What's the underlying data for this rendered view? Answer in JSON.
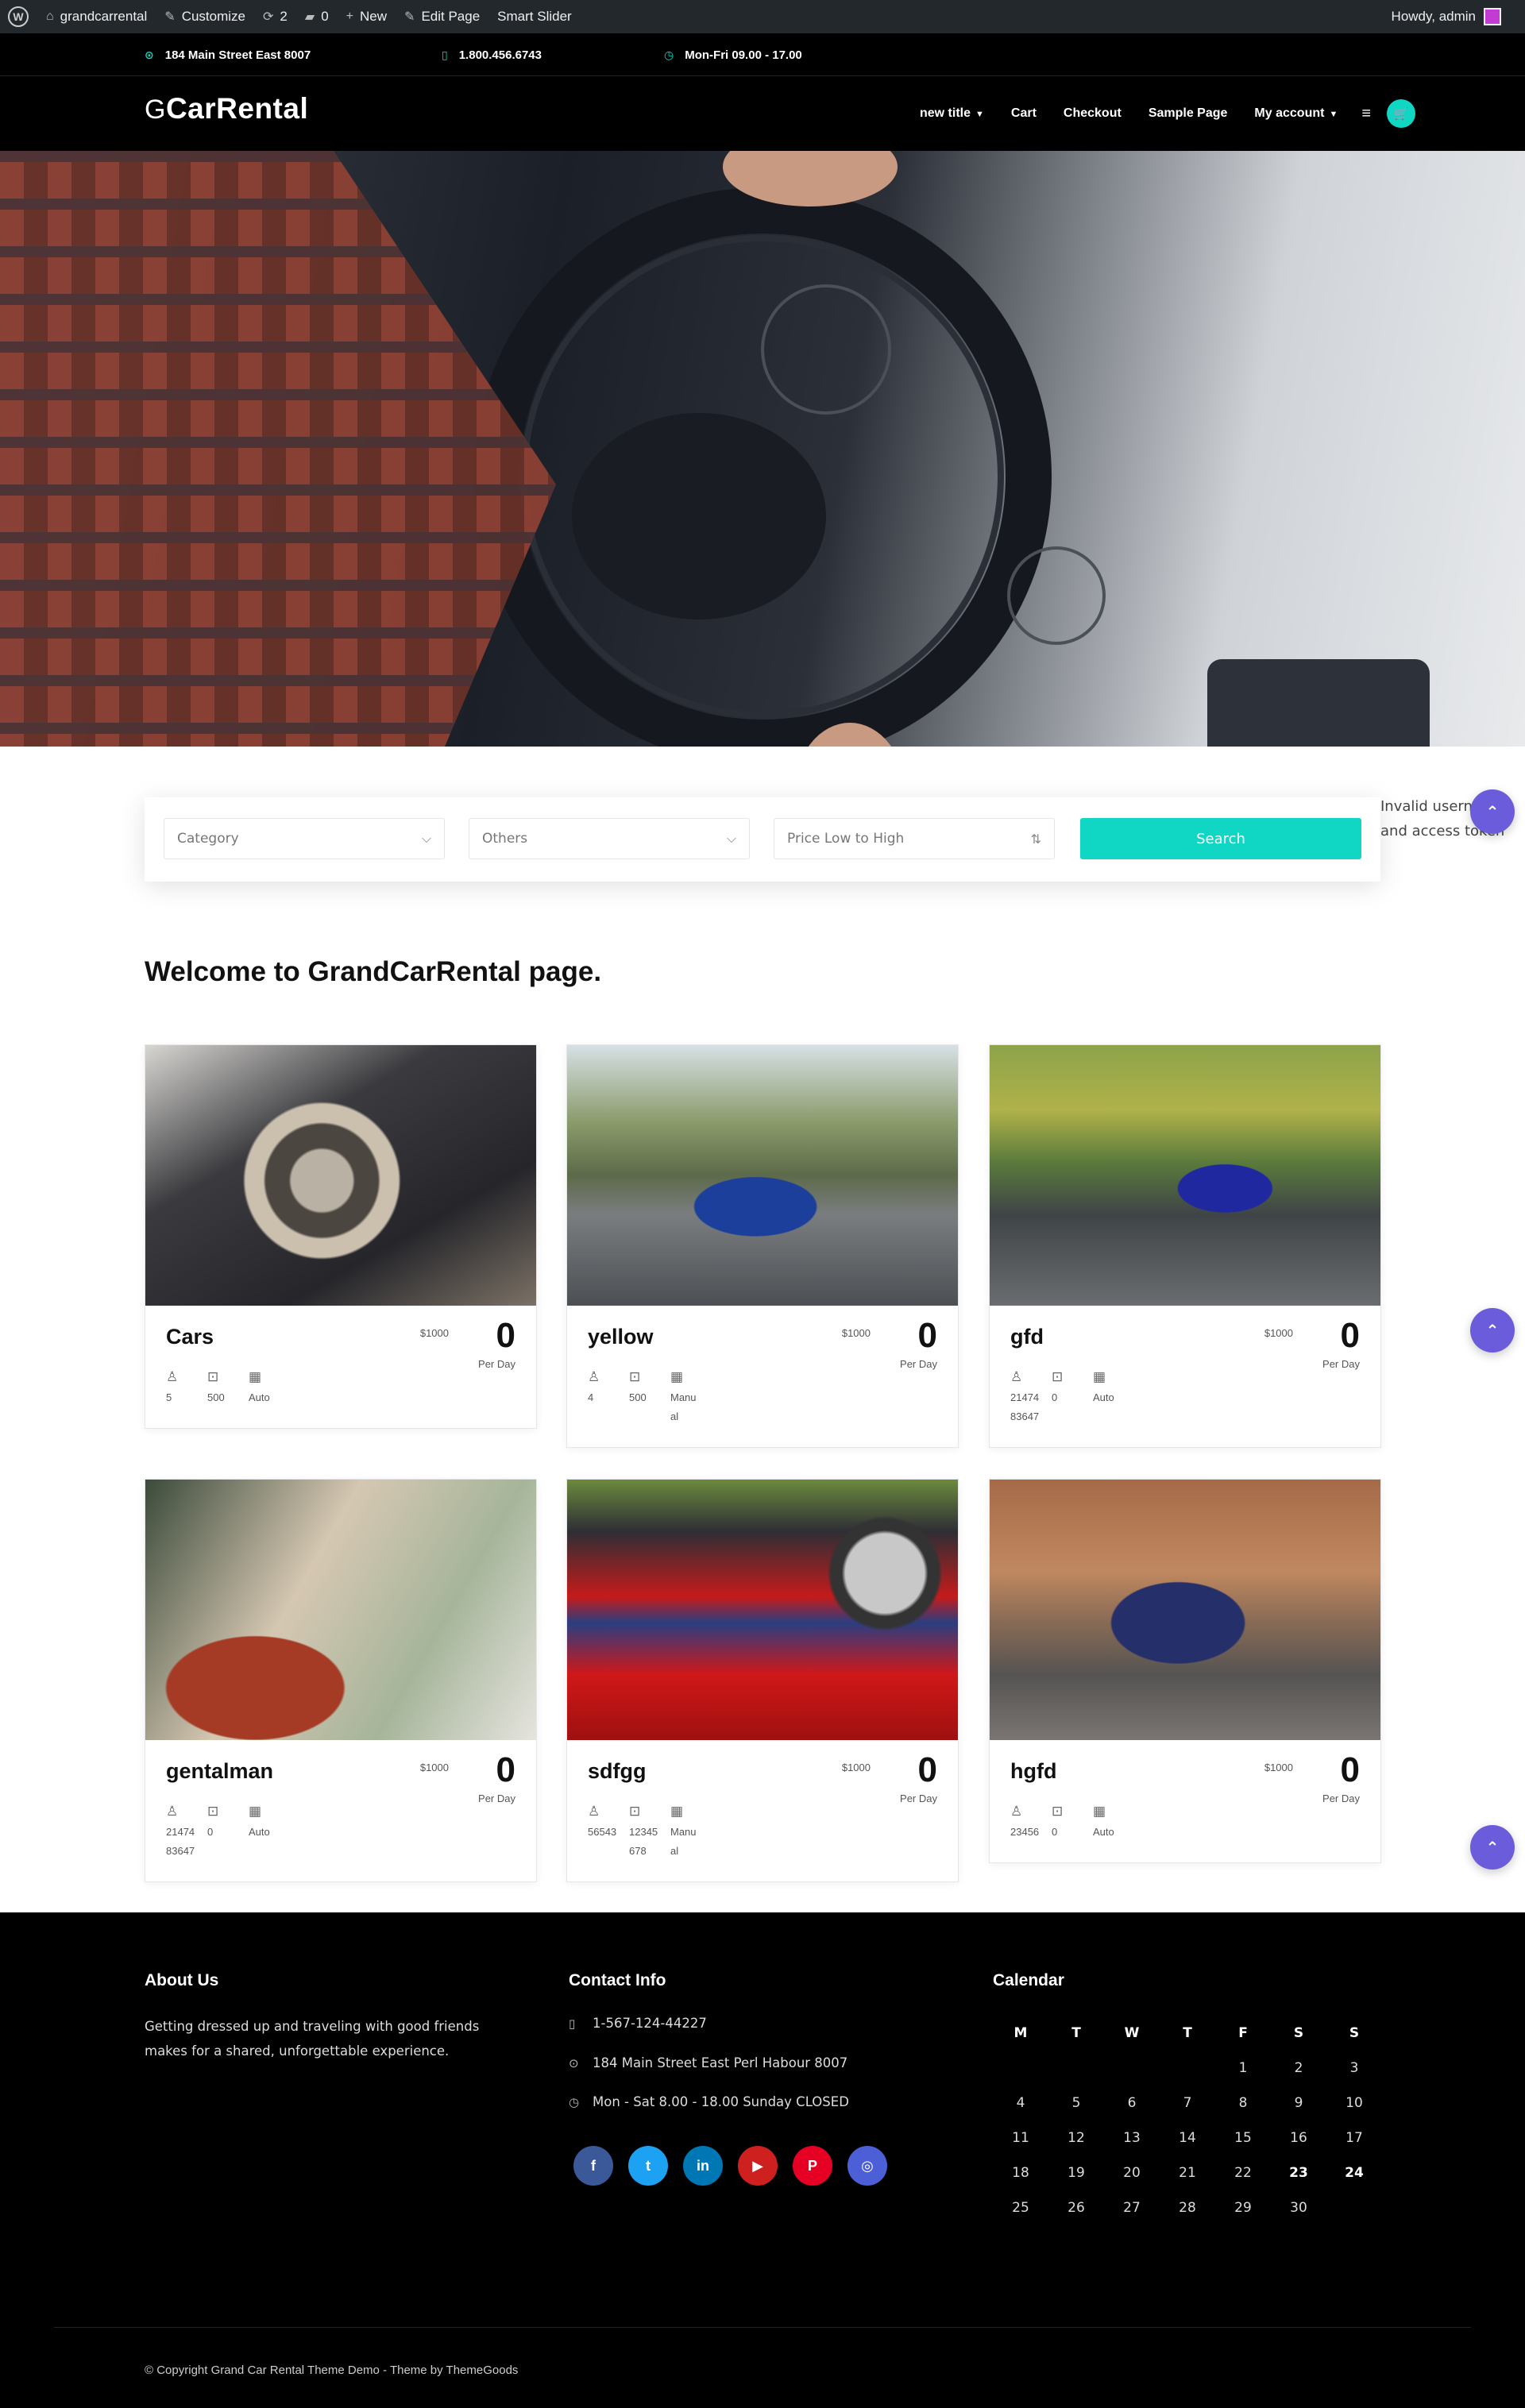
{
  "admin_bar": {
    "site": "grandcarrental",
    "customize": "Customize",
    "updates": "2",
    "comments": "0",
    "new": "New",
    "edit_page": "Edit Page",
    "smart_slider": "Smart Slider",
    "howdy": "Howdy, admin"
  },
  "topbar": {
    "address": "184 Main Street East 8007",
    "phone": "1.800.456.6743",
    "hours": "Mon-Fri 09.00 - 17.00"
  },
  "header": {
    "logo_mark": "G",
    "logo_text": "CarRental",
    "nav": [
      "new title",
      "Cart",
      "Checkout",
      "Sample Page",
      "My account"
    ]
  },
  "search": {
    "category": "Category",
    "others": "Others",
    "sort": "Price Low to High",
    "button": "Search"
  },
  "invalid_notice": {
    "line1": "Invalid username",
    "line2": "and access token"
  },
  "welcome": "Welcome to GrandCarRental page.",
  "cards": [
    {
      "title": "Cars",
      "price_small": "$1000",
      "price": "0",
      "per_day": "Per Day",
      "seats": "5",
      "bags": "500",
      "trans": "Auto"
    },
    {
      "title": "yellow",
      "price_small": "$1000",
      "price": "0",
      "per_day": "Per Day",
      "seats": "4",
      "bags": "500",
      "trans": "Manu al"
    },
    {
      "title": "gfd",
      "price_small": "$1000",
      "price": "0",
      "per_day": "Per Day",
      "seats": "21474 83647",
      "bags": "0",
      "trans": "Auto"
    },
    {
      "title": "gentalman",
      "price_small": "$1000",
      "price": "0",
      "per_day": "Per Day",
      "seats": "21474 83647",
      "bags": "0",
      "trans": "Auto"
    },
    {
      "title": "sdfgg",
      "price_small": "$1000",
      "price": "0",
      "per_day": "Per Day",
      "seats": "56543",
      "bags": "12345 678",
      "trans": "Manu al"
    },
    {
      "title": "hgfd",
      "price_small": "$1000",
      "price": "0",
      "per_day": "Per Day",
      "seats": "23456",
      "bags": "0",
      "trans": "Auto"
    }
  ],
  "footer": {
    "about_title": "About Us",
    "about_text": "Getting dressed up and traveling with good friends makes for a shared, unforgettable experience.",
    "contact_title": "Contact Info",
    "contact_phone": "1-567-124-44227",
    "contact_address": "184 Main Street East Perl Habour 8007",
    "contact_hours": "Mon - Sat 8.00 - 18.00 Sunday CLOSED",
    "calendar_title": "Calendar",
    "calendar_days": [
      "M",
      "T",
      "W",
      "T",
      "F",
      "S",
      "S"
    ],
    "calendar_weeks": [
      [
        "",
        "",
        "",
        "",
        "1",
        "2",
        "3"
      ],
      [
        "4",
        "5",
        "6",
        "7",
        "8",
        "9",
        "10"
      ],
      [
        "11",
        "12",
        "13",
        "14",
        "15",
        "16",
        "17"
      ],
      [
        "18",
        "19",
        "20",
        "21",
        "22",
        "23",
        "24"
      ],
      [
        "25",
        "26",
        "27",
        "28",
        "29",
        "30",
        ""
      ]
    ],
    "copyright": "© Copyright Grand Car Rental Theme Demo - Theme by ThemeGoods"
  },
  "social": [
    {
      "icon": "facebook-icon",
      "glyph": "f",
      "color": "#3b5998"
    },
    {
      "icon": "twitter-icon",
      "glyph": "t",
      "color": "#1da1f2"
    },
    {
      "icon": "linkedin-icon",
      "glyph": "in",
      "color": "#0077b5"
    },
    {
      "icon": "youtube-icon",
      "glyph": "▶",
      "color": "#cd201f"
    },
    {
      "icon": "pinterest-icon",
      "glyph": "P",
      "color": "#e60023"
    },
    {
      "icon": "instagram-icon",
      "glyph": "◎",
      "color": "#4c5fd7"
    }
  ],
  "colors": {
    "accent": "#0fd7c4",
    "fab": "#6a5cdb",
    "dark": "#000000"
  }
}
